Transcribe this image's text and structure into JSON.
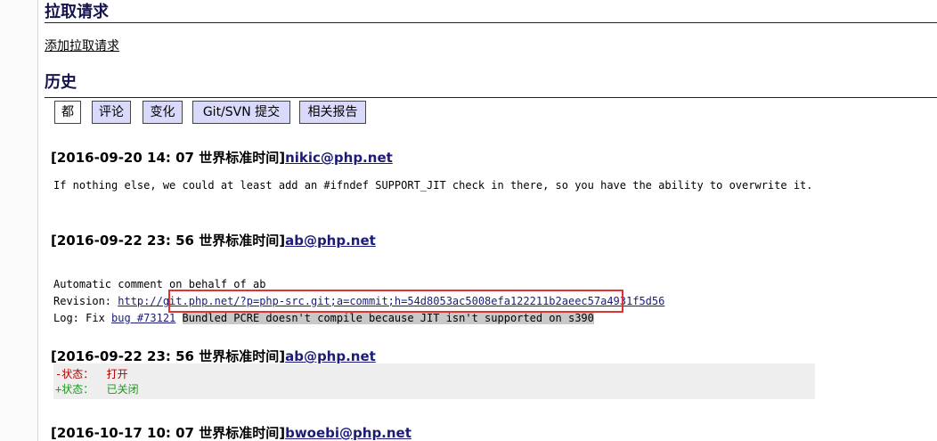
{
  "colors": {
    "heading": "#14144f",
    "link": "#1c1c78",
    "tab_inactive_bg": "#d9d9fb",
    "tab_active_bg": "#ffffff",
    "diff_bg": "#eeeeee",
    "diff_removed": "#b00000",
    "diff_added": "#1a9a1a",
    "text_highlight": "#c8c8c8",
    "annotation_box": "#e03434"
  },
  "pull_requests": {
    "heading": "拉取请求",
    "add_link": "添加拉取请求"
  },
  "history": {
    "heading": "历史",
    "tabs": [
      {
        "label": "都",
        "active": true
      },
      {
        "label": "评论",
        "active": false
      },
      {
        "label": "变化",
        "active": false
      },
      {
        "label": "Git/SVN 提交",
        "active": false
      },
      {
        "label": "相关报告",
        "active": false
      }
    ]
  },
  "comments": [
    {
      "timestamp": "[2016-09-20 14: 07 世界标准时间]",
      "author": "nikic@php.net",
      "body": "If nothing else, we could at least add an #ifndef SUPPORT_JIT check in there, so you have the ability to overwrite it."
    },
    {
      "timestamp": "[2016-09-22 23: 56 世界标准时间]",
      "author": "ab@php.net",
      "intro": "Automatic comment on behalf of ab",
      "revision_label": "Revision: ",
      "revision_url": "http://git.php.net/?p=php-src.git;a=commit;h=54d8053ac5008efa122211b2aeec57a4931f5d56",
      "log_label": "Log: Fix ",
      "log_bug_link": "bug #73121",
      "log_title": "Bundled PCRE doesn't compile because JIT isn't supported on s390"
    },
    {
      "timestamp": "[2016-09-22 23: 56 世界标准时间]",
      "author": "ab@php.net",
      "changes": {
        "removed": "-状态：  打开",
        "added": "+状态：  已关闭"
      }
    },
    {
      "timestamp": "[2016-10-17 10: 07 世界标准时间]",
      "author": "bwoebi@php.net"
    }
  ]
}
